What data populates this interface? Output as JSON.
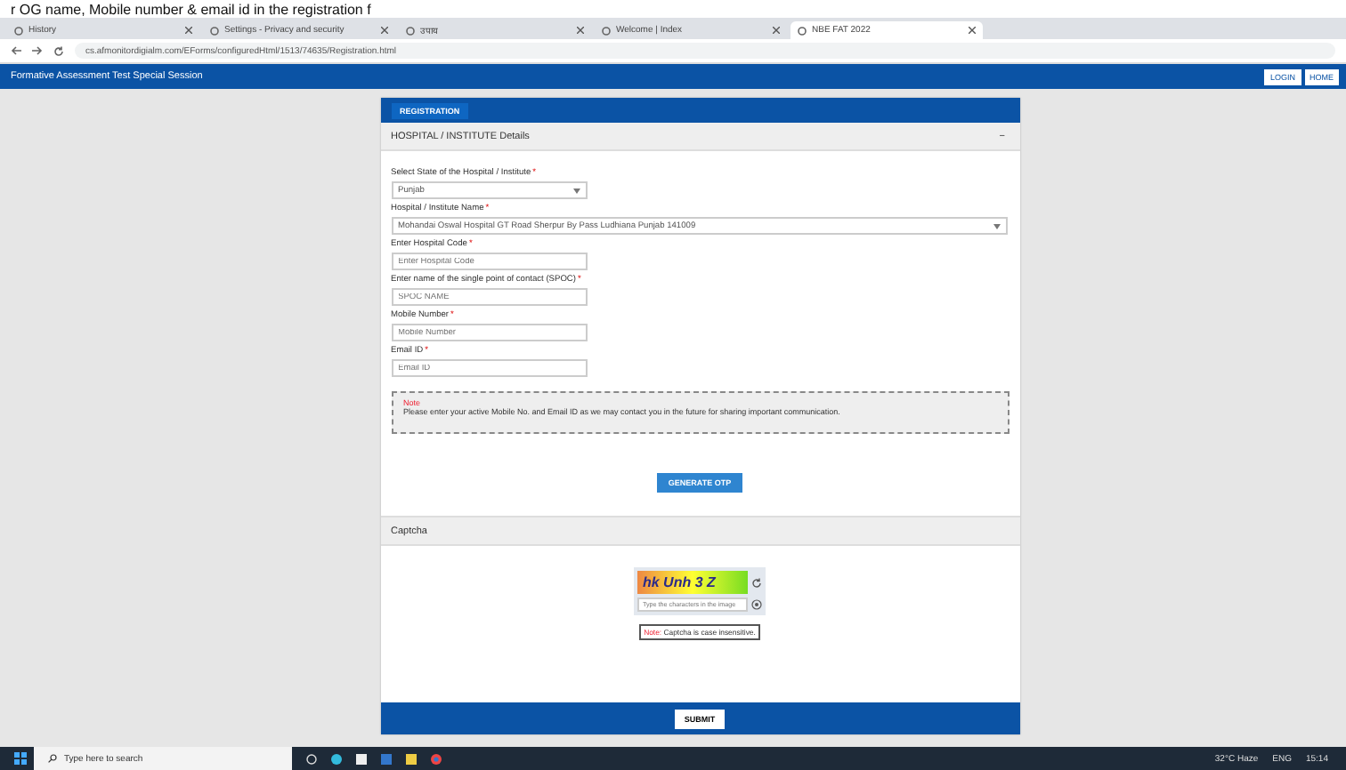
{
  "caption": "r OG name, Mobile number & email id in the registration f",
  "browser": {
    "tabs": [
      {
        "title": "History",
        "selected": false
      },
      {
        "title": "Settings - Privacy and security",
        "selected": false
      },
      {
        "title": "उपाय",
        "selected": false
      },
      {
        "title": "Welcome | Index",
        "selected": false
      },
      {
        "title": "NBE FAT 2022",
        "selected": true
      }
    ],
    "url": "cs.afmonitordigialm.com/EForms/configuredHtml/1513/74635/Registration.html"
  },
  "header": {
    "title": "Formative Assessment Test  Special Session",
    "buttons": [
      "LOGIN",
      "HOME"
    ]
  },
  "form": {
    "tab": "REGISTRATION",
    "section": "HOSPITAL / INSTITUTE Details",
    "collapse": "−",
    "fields": [
      {
        "kind": "select",
        "label": "Select State of the Hospital / Institute",
        "mark": "*",
        "value": "Punjab",
        "wide": false
      },
      {
        "kind": "select",
        "label": "Hospital / Institute Name",
        "mark": "*",
        "value": "Mohandai Oswal Hospital GT Road Sherpur By Pass Ludhiana Punjab 141009",
        "wide": true
      },
      {
        "kind": "text",
        "label": "Enter Hospital Code",
        "mark": "*",
        "placeholder": "Enter Hospital Code",
        "wide": false
      },
      {
        "kind": "text",
        "label": "Enter name of the single point of contact (SPOC)",
        "mark": "*",
        "placeholder": "SPOC NAME",
        "wide": false
      },
      {
        "kind": "text",
        "label": "Mobile Number",
        "mark": "*",
        "placeholder": "Mobile Number",
        "wide": false
      },
      {
        "kind": "text",
        "label": "Email ID",
        "mark": "*",
        "placeholder": "Email ID",
        "wide": false
      }
    ],
    "note_title": "Note",
    "note": "Please enter your active Mobile No. and Email ID as we may contact you in the future for sharing important communication.",
    "otp_button": "GENERATE OTP",
    "captcha_section": "Captcha",
    "captcha_text": "hk Unh 3 Z",
    "captcha_placeholder": "Type the characters in the image",
    "captcha_note": "**Note:** Captcha is case insensitive.",
    "submit": "SUBMIT"
  },
  "taskbar": {
    "search": "Type here to search",
    "weather": "32°C Haze",
    "language": "ENG",
    "time": "15:14"
  }
}
